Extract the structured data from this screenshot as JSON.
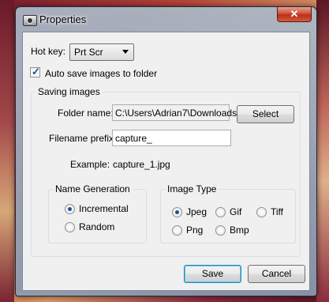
{
  "window": {
    "title": "Properties",
    "close_label": "✕"
  },
  "hotkey": {
    "label": "Hot key:",
    "value": "Prt Scr"
  },
  "auto_save": {
    "label": "Auto save images to folder",
    "checked": true
  },
  "saving_images": {
    "group_label": "Saving images",
    "folder_label": "Folder name:",
    "folder_value": "C:\\Users\\Adrian7\\Downloads",
    "select_label": "Select",
    "prefix_label": "Filename prefix:",
    "prefix_value": "capture_",
    "example_label": "Example:",
    "example_value": "capture_1.jpg"
  },
  "name_generation": {
    "group_label": "Name Generation",
    "options": [
      "Incremental",
      "Random"
    ],
    "selected": "Incremental"
  },
  "image_type": {
    "group_label": "Image Type",
    "options": [
      "Jpeg",
      "Gif",
      "Tiff",
      "Png",
      "Bmp"
    ],
    "selected": "Jpeg"
  },
  "footer": {
    "save_label": "Save",
    "cancel_label": "Cancel"
  }
}
